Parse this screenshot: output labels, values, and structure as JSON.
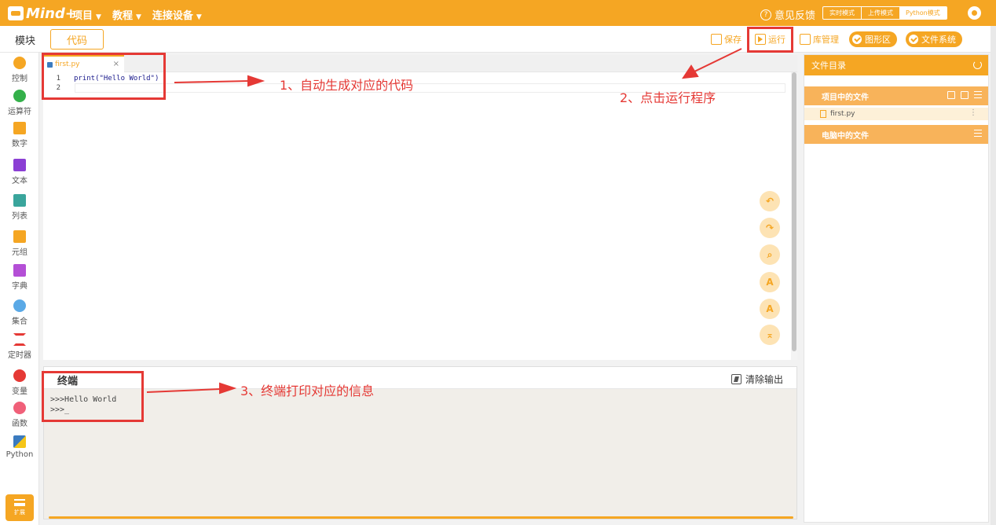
{
  "topbar": {
    "logo": "Mind+",
    "menus": [
      {
        "label": "项目"
      },
      {
        "label": "教程"
      },
      {
        "label": "连接设备"
      }
    ],
    "feedback": "意见反馈",
    "modes": [
      "实时模式",
      "上传模式",
      "Python模式"
    ],
    "active_mode": "Python模式",
    "accent_color": "#f5a623"
  },
  "toolbar": {
    "tab_blocks": "模块",
    "tab_code": "代码",
    "save": "保存",
    "run": "运行",
    "library": "库管理",
    "graphics": "图形区",
    "filesystem": "文件系统"
  },
  "sidebar": {
    "categories": [
      {
        "label": "控制",
        "color": "#f5a623",
        "icon": "circle"
      },
      {
        "label": "运算符",
        "color": "#34b04a",
        "icon": "circle"
      },
      {
        "label": "数字",
        "color": "#f5a623",
        "icon": "number-block"
      },
      {
        "label": "文本",
        "color": "#8b3fd4",
        "icon": "text-block"
      },
      {
        "label": "列表",
        "color": "#3aa59c",
        "icon": "list-block"
      },
      {
        "label": "元组",
        "color": "#f5a623",
        "icon": "tuple-lock"
      },
      {
        "label": "字典",
        "color": "#b44fd6",
        "icon": "dict-block"
      },
      {
        "label": "集合",
        "color": "#5aa9e6",
        "icon": "set-cluster"
      },
      {
        "label": "定时器",
        "color": "#e53935",
        "icon": "hourglass"
      },
      {
        "label": "变量",
        "color": "#e53935",
        "icon": "circle"
      },
      {
        "label": "函数",
        "color": "#f06079",
        "icon": "circle"
      },
      {
        "label": "Python",
        "color": "#3b7bbf",
        "icon": "python-logo"
      }
    ],
    "extension": "扩展"
  },
  "editor": {
    "tab_name": "first.py",
    "lines": [
      {
        "num": "1",
        "code": "print(\"Hello World\")"
      },
      {
        "num": "2",
        "code": ""
      }
    ]
  },
  "terminal": {
    "title": "终端",
    "clear": "清除输出",
    "output": [
      ">>>Hello World",
      ">>>_"
    ]
  },
  "file_panel": {
    "title": "文件目录",
    "project_files": "项目中的文件",
    "file": "first.py",
    "computer_files": "电脑中的文件"
  },
  "annotations": {
    "note1": "1、自动生成对应的代码",
    "note2": "2、点击运行程序",
    "note3": "3、终端打印对应的信息",
    "color": "#e53935"
  }
}
